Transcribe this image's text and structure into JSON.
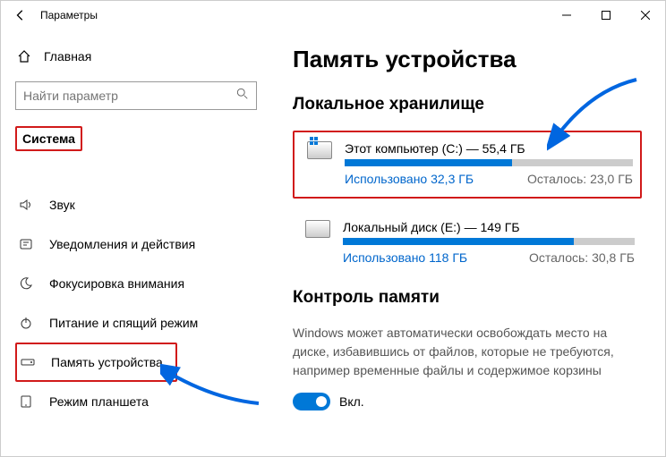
{
  "window": {
    "title": "Параметры"
  },
  "sidebar": {
    "home": "Главная",
    "search_placeholder": "Найти параметр",
    "category": "Система",
    "items": [
      {
        "label": "Звук",
        "icon": "speaker-icon"
      },
      {
        "label": "Уведомления и действия",
        "icon": "notification-icon"
      },
      {
        "label": "Фокусировка внимания",
        "icon": "moon-icon"
      },
      {
        "label": "Питание и спящий режим",
        "icon": "power-icon"
      },
      {
        "label": "Память устройства",
        "icon": "storage-icon"
      },
      {
        "label": "Режим планшета",
        "icon": "tablet-icon"
      }
    ]
  },
  "main": {
    "title": "Память устройства",
    "local_section": "Локальное хранилище",
    "drives": [
      {
        "name": "Этот компьютер (C:) — 55,4 ГБ",
        "used_label": "Использовано 32,3 ГБ",
        "free_label": "Осталось: 23,0 ГБ",
        "fill_percent": 58,
        "system": true
      },
      {
        "name": "Локальный диск (E:) — 149 ГБ",
        "used_label": "Использовано 118 ГБ",
        "free_label": "Осталось: 30,8 ГБ",
        "fill_percent": 79,
        "system": false
      }
    ],
    "sense_section": "Контроль памяти",
    "sense_text": "Windows может автоматически освобождать место на диске, избавившись от файлов, которые не требуются, например временные файлы и содержимое корзины",
    "toggle_label": "Вкл.",
    "toggle_on": true
  }
}
